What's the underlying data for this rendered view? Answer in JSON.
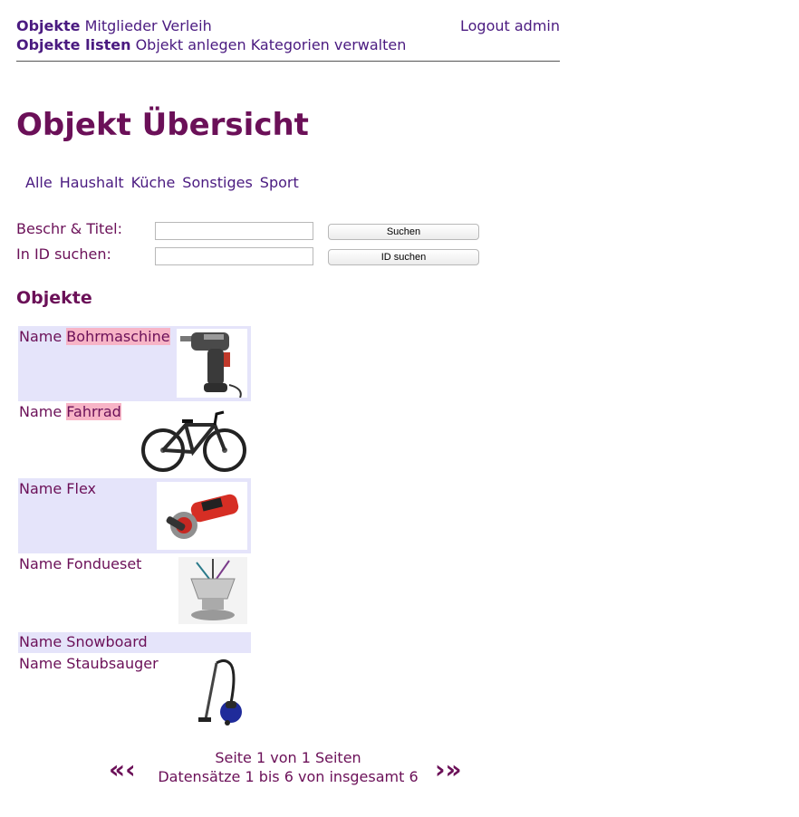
{
  "nav": {
    "main_active": "Objekte",
    "main_items": [
      "Mitglieder",
      "Verleih"
    ],
    "logout": "Logout admin",
    "sub_active": "Objekte listen",
    "sub_items": [
      "Objekt anlegen",
      "Kategorien verwalten"
    ]
  },
  "page_title": "Objekt Übersicht",
  "categories": [
    "Alle",
    "Haushalt",
    "Küche",
    "Sonstiges",
    "Sport"
  ],
  "search": {
    "title_label": "Beschr & Titel:",
    "title_value": "",
    "title_button": "Suchen",
    "id_label": "In ID suchen:",
    "id_value": "",
    "id_button": "ID suchen"
  },
  "section_title": "Objekte",
  "objects": [
    {
      "prefix": "Name",
      "name": "Bohrmaschine",
      "highlighted": true,
      "icon": "drill-image"
    },
    {
      "prefix": "Name",
      "name": "Fahrrad",
      "highlighted": true,
      "icon": "bicycle-image"
    },
    {
      "prefix": "Name",
      "name": "Flex",
      "highlighted": false,
      "icon": "angle-grinder-image"
    },
    {
      "prefix": "Name",
      "name": "Fondueset",
      "highlighted": false,
      "icon": "fondue-set-image"
    },
    {
      "prefix": "Name",
      "name": "Snowboard",
      "highlighted": false,
      "icon": ""
    },
    {
      "prefix": "Name",
      "name": "Staubsauger",
      "highlighted": false,
      "icon": "vacuum-cleaner-image"
    }
  ],
  "pagination": {
    "page_text": "Seite 1 von 1 Seiten",
    "records_text": "Datensätze 1 bis 6 von insgesamt 6",
    "prev_symbol": "«‹",
    "next_symbol": "›»"
  },
  "colors": {
    "link": "#4a1a80",
    "heading": "#6b1058",
    "row_alt": "#e5e4fa",
    "highlight": "#f7b4c6"
  }
}
